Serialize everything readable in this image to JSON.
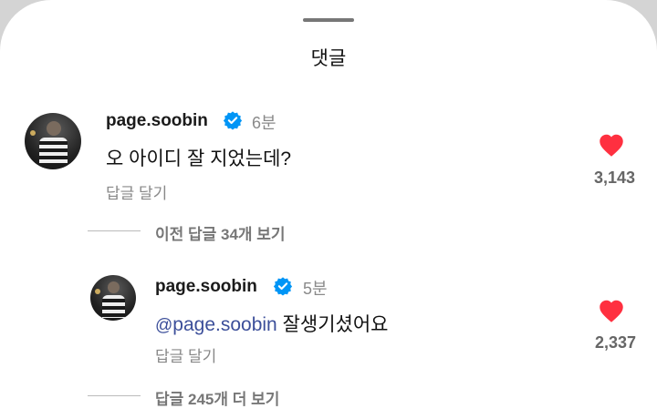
{
  "sheet": {
    "title": "댓글"
  },
  "comments": [
    {
      "username": "page.soobin",
      "time": "6분",
      "text": "오 아이디 잘 지었는데?",
      "reply_label": "답글 달기",
      "likes": "3,143",
      "liked": true,
      "verified": true
    },
    {
      "username": "page.soobin",
      "time": "5분",
      "mention_icon": "threads-icon",
      "mention": "page.soobin",
      "text": " 잘생기셨어요",
      "reply_label": "답글 달기",
      "likes": "2,337",
      "liked": true,
      "verified": true
    }
  ],
  "view_previous_replies": "이전 답글 34개 보기",
  "view_more_replies": "답글 245개 더 보기",
  "colors": {
    "heart": "#ff3040",
    "verified": "#0095f6",
    "mention": "#3c4f9a"
  }
}
